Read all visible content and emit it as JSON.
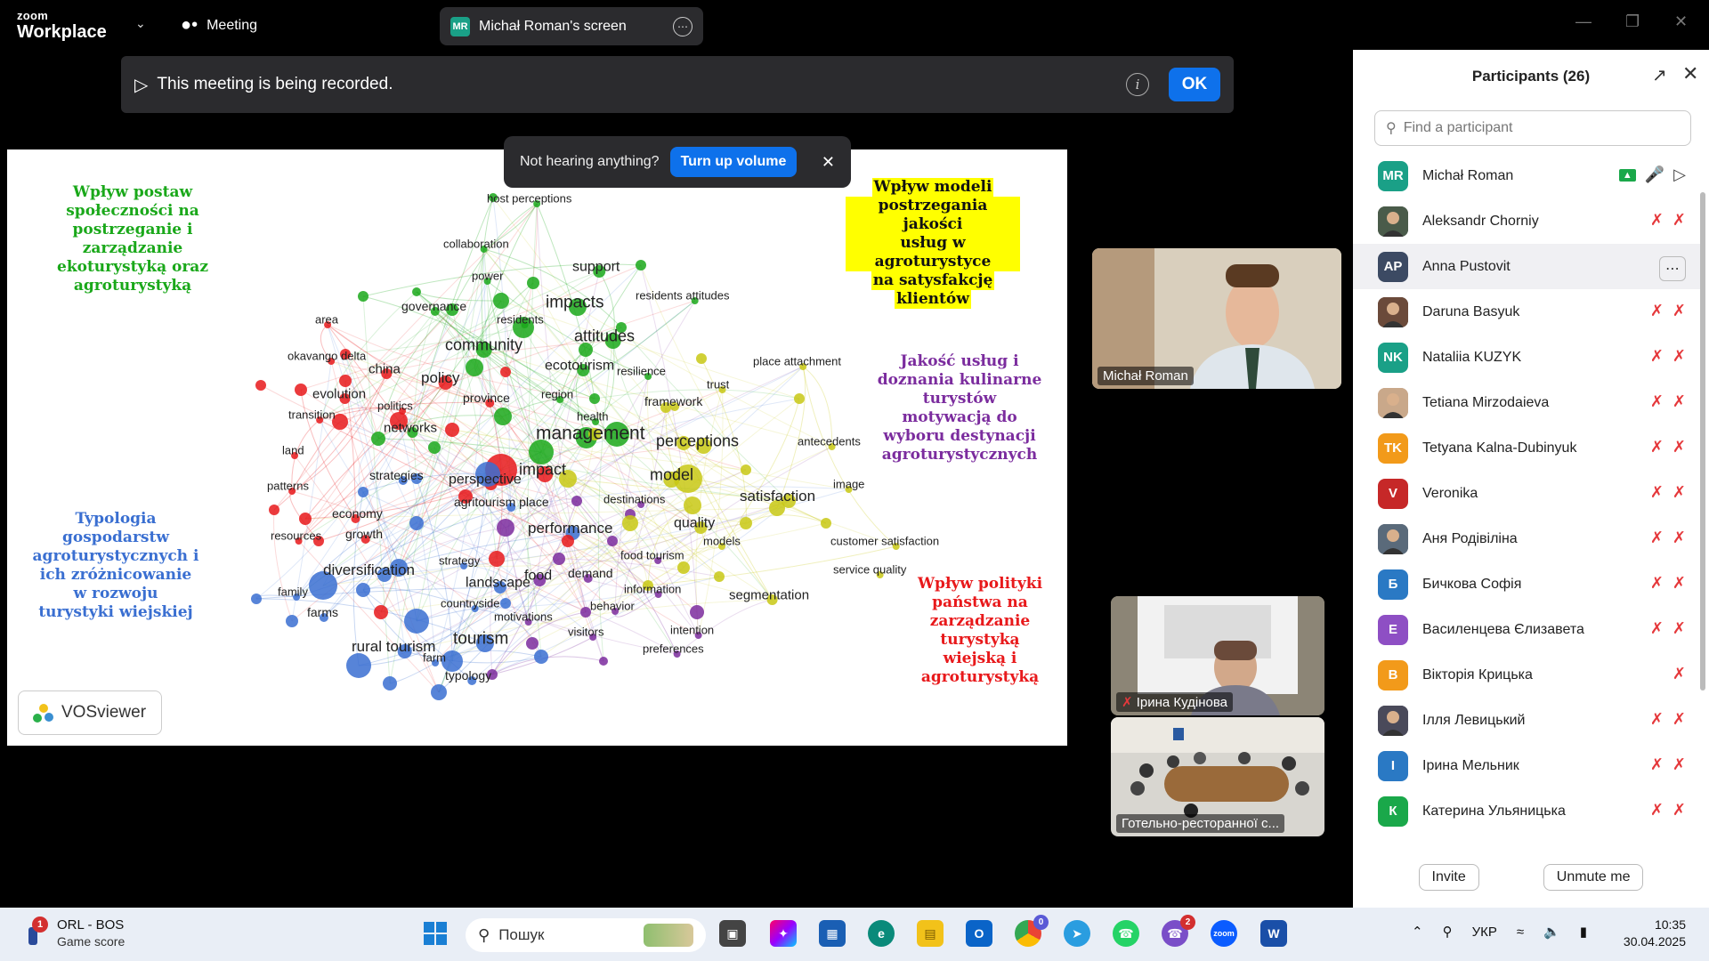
{
  "app": {
    "logo_line1": "zoom",
    "logo_line2": "Workplace",
    "meeting_label": "Meeting",
    "screen_tab": {
      "initials": "MR",
      "label": "Michał Roman's screen"
    }
  },
  "recording_banner": {
    "text": "This meeting is being recorded.",
    "ok_label": "OK"
  },
  "volume_toast": {
    "text": "Not hearing anything?",
    "button": "Turn up volume"
  },
  "slide": {
    "cluster_labels": {
      "green": [
        "Wpływ postaw",
        "społeczności na",
        "postrzeganie i",
        "zarządzanie",
        "ekoturystyką oraz",
        "agroturystyką"
      ],
      "yellow": [
        "Wpływ modeli",
        "postrzegania jakości",
        "usług w agroturystyce",
        "na satysfakcję",
        "klientów"
      ],
      "purple": [
        "Jakość usług i",
        "doznania kulinarne",
        "turystów",
        "motywacją do",
        "wyboru destynacji",
        "agroturystycznych"
      ],
      "blue": [
        "Typologia",
        "gospodarstw",
        "agroturystycznych i",
        "ich zróżnicowanie",
        "w rozwoju",
        "turystyki wiejskiej"
      ],
      "red": [
        "Wpływ polityki",
        "państwa na",
        "zarządzanie",
        "turystyką",
        "wiejską i",
        "agroturystyką"
      ]
    },
    "colors": {
      "green": "#1aa81a",
      "yellow": "#c8c814",
      "purple": "#7b2c9e",
      "blue": "#3a6fd1",
      "red": "#e8191b",
      "highlight": "#ffff00"
    },
    "vosviewer_label": "VOSviewer",
    "terms": [
      {
        "t": "host perceptions",
        "c": "green",
        "s": 13
      },
      {
        "t": "collaboration",
        "c": "green",
        "s": 13
      },
      {
        "t": "power",
        "c": "green",
        "s": 13
      },
      {
        "t": "support",
        "c": "green",
        "s": 16
      },
      {
        "t": "governance",
        "c": "green",
        "s": 14
      },
      {
        "t": "impacts",
        "c": "green",
        "s": 19
      },
      {
        "t": "residents attitudes",
        "c": "green",
        "s": 13
      },
      {
        "t": "residents",
        "c": "green",
        "s": 13
      },
      {
        "t": "attitudes",
        "c": "green",
        "s": 18
      },
      {
        "t": "community",
        "c": "green",
        "s": 18
      },
      {
        "t": "ecotourism",
        "c": "green",
        "s": 16
      },
      {
        "t": "resilience",
        "c": "green",
        "s": 13
      },
      {
        "t": "region",
        "c": "green",
        "s": 13
      },
      {
        "t": "networks",
        "c": "green",
        "s": 15
      },
      {
        "t": "health",
        "c": "green",
        "s": 13
      },
      {
        "t": "management",
        "c": "green",
        "s": 21
      },
      {
        "t": "area",
        "c": "red",
        "s": 13
      },
      {
        "t": "okavango delta",
        "c": "red",
        "s": 13
      },
      {
        "t": "china",
        "c": "red",
        "s": 15
      },
      {
        "t": "policy",
        "c": "red",
        "s": 17
      },
      {
        "t": "evolution",
        "c": "red",
        "s": 15
      },
      {
        "t": "transition",
        "c": "red",
        "s": 13
      },
      {
        "t": "politics",
        "c": "red",
        "s": 13
      },
      {
        "t": "province",
        "c": "red",
        "s": 14
      },
      {
        "t": "land",
        "c": "red",
        "s": 13
      },
      {
        "t": "patterns",
        "c": "red",
        "s": 13
      },
      {
        "t": "impact",
        "c": "red",
        "s": 18
      },
      {
        "t": "perspective",
        "c": "red",
        "s": 16
      },
      {
        "t": "economy",
        "c": "red",
        "s": 14
      },
      {
        "t": "resources",
        "c": "red",
        "s": 13
      },
      {
        "t": "growth",
        "c": "red",
        "s": 14
      },
      {
        "t": "strategies",
        "c": "blue",
        "s": 14
      },
      {
        "t": "agritourism place",
        "c": "blue",
        "s": 14
      },
      {
        "t": "performance",
        "c": "blue",
        "s": 17
      },
      {
        "t": "diversification",
        "c": "blue",
        "s": 17
      },
      {
        "t": "strategy",
        "c": "blue",
        "s": 13
      },
      {
        "t": "landscape",
        "c": "blue",
        "s": 16
      },
      {
        "t": "family",
        "c": "blue",
        "s": 13
      },
      {
        "t": "countryside",
        "c": "blue",
        "s": 13
      },
      {
        "t": "farms",
        "c": "blue",
        "s": 14
      },
      {
        "t": "tourism",
        "c": "blue",
        "s": 19
      },
      {
        "t": "rural tourism",
        "c": "blue",
        "s": 17
      },
      {
        "t": "farm",
        "c": "blue",
        "s": 13
      },
      {
        "t": "typology",
        "c": "blue",
        "s": 14
      },
      {
        "t": "motivations",
        "c": "purple",
        "s": 13
      },
      {
        "t": "food",
        "c": "purple",
        "s": 16
      },
      {
        "t": "demand",
        "c": "purple",
        "s": 14
      },
      {
        "t": "food tourism",
        "c": "purple",
        "s": 13
      },
      {
        "t": "information",
        "c": "purple",
        "s": 13
      },
      {
        "t": "behavior",
        "c": "purple",
        "s": 13
      },
      {
        "t": "visitors",
        "c": "purple",
        "s": 13
      },
      {
        "t": "intention",
        "c": "purple",
        "s": 13
      },
      {
        "t": "preferences",
        "c": "purple",
        "s": 13
      },
      {
        "t": "destinations",
        "c": "purple",
        "s": 13
      },
      {
        "t": "place attachment",
        "c": "yellow",
        "s": 13
      },
      {
        "t": "trust",
        "c": "yellow",
        "s": 13
      },
      {
        "t": "framework",
        "c": "yellow",
        "s": 14
      },
      {
        "t": "perceptions",
        "c": "yellow",
        "s": 18
      },
      {
        "t": "antecedents",
        "c": "yellow",
        "s": 13
      },
      {
        "t": "model",
        "c": "yellow",
        "s": 18
      },
      {
        "t": "image",
        "c": "yellow",
        "s": 13
      },
      {
        "t": "satisfaction",
        "c": "yellow",
        "s": 17
      },
      {
        "t": "quality",
        "c": "yellow",
        "s": 16
      },
      {
        "t": "models",
        "c": "yellow",
        "s": 13
      },
      {
        "t": "customer satisfaction",
        "c": "yellow",
        "s": 13
      },
      {
        "t": "service quality",
        "c": "yellow",
        "s": 13
      },
      {
        "t": "segmentation",
        "c": "yellow",
        "s": 15
      }
    ]
  },
  "video_tiles": {
    "speaker_name": "Michał Roman",
    "tile2_name": "Ірина Кудінова",
    "tile3_name": "Готельно-ресторанної с..."
  },
  "participants": {
    "title": "Participants (26)",
    "search_placeholder": "Find a participant",
    "invite_label": "Invite",
    "unmute_label": "Unmute me",
    "list": [
      {
        "name": "Michał Roman",
        "initials": "MR",
        "color": "#1aa087",
        "host": true
      },
      {
        "name": "Aleksandr Chorniy",
        "initials": "",
        "color": "#4a5b4a",
        "photo": true
      },
      {
        "name": "Anna Pustovit",
        "initials": "AP",
        "color": "#3c4a63",
        "highlight": true
      },
      {
        "name": "Daruna Basyuk",
        "initials": "",
        "color": "#6b4a3a",
        "photo": true
      },
      {
        "name": "Nataliia KUZYK",
        "initials": "NK",
        "color": "#1aa087"
      },
      {
        "name": "Tetiana Mirzodaieva",
        "initials": "",
        "color": "#c9a88a",
        "photo": true
      },
      {
        "name": "Tetyana Kalna-Dubinyuk",
        "initials": "TK",
        "color": "#f29a1a"
      },
      {
        "name": "Veronika",
        "initials": "V",
        "color": "#c62828"
      },
      {
        "name": "Аня Родівіліна",
        "initials": "",
        "color": "#5a6a7a",
        "photo": true
      },
      {
        "name": "Бичкова Софія",
        "initials": "Б",
        "color": "#2a79c4"
      },
      {
        "name": "Василенцева Єлизавета",
        "initials": "Е",
        "color": "#8e4fc4"
      },
      {
        "name": "Вікторія Крицька",
        "initials": "В",
        "color": "#f29a1a",
        "no_mic": true
      },
      {
        "name": "Ілля Левицький",
        "initials": "",
        "color": "#4a4a5a",
        "photo": true
      },
      {
        "name": "Ірина Мельник",
        "initials": "І",
        "color": "#2a79c4"
      },
      {
        "name": "Катерина Ульяницька",
        "initials": "К",
        "color": "#1aa84a"
      }
    ]
  },
  "taskbar": {
    "weather_badge": "1",
    "weather_title": "ORL - BOS",
    "weather_sub": "Game score",
    "search_placeholder": "Пошук",
    "chrome_badge": "0",
    "viber_badge": "2",
    "lang": "УКР",
    "time": "10:35",
    "date": "30.04.2025"
  }
}
